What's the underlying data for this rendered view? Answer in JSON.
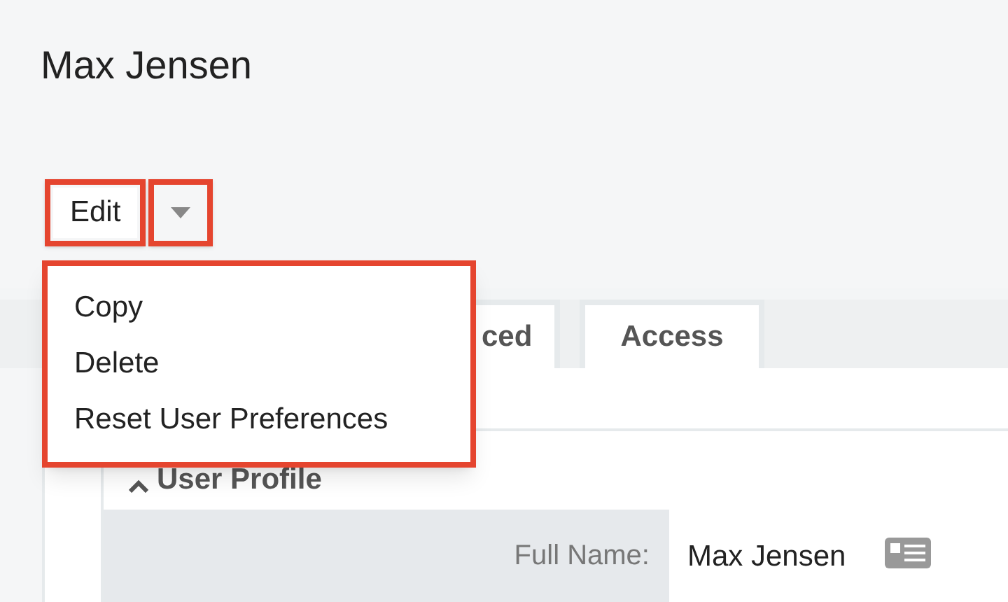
{
  "page_title": "Max Jensen",
  "edit_button": {
    "label": "Edit",
    "highlighted": true
  },
  "dropdown_toggle": {
    "highlighted": true
  },
  "actions_menu": {
    "highlighted": true,
    "items": [
      {
        "label": "Copy"
      },
      {
        "label": "Delete"
      },
      {
        "label": "Reset User Preferences"
      }
    ]
  },
  "tabs": [
    {
      "label": "ced",
      "selected": false
    },
    {
      "label": "Access",
      "selected": false
    }
  ],
  "panel": {
    "title": "User Profile",
    "expanded": true,
    "fields": [
      {
        "label": "Full Name:",
        "value": "Max Jensen"
      }
    ]
  }
}
